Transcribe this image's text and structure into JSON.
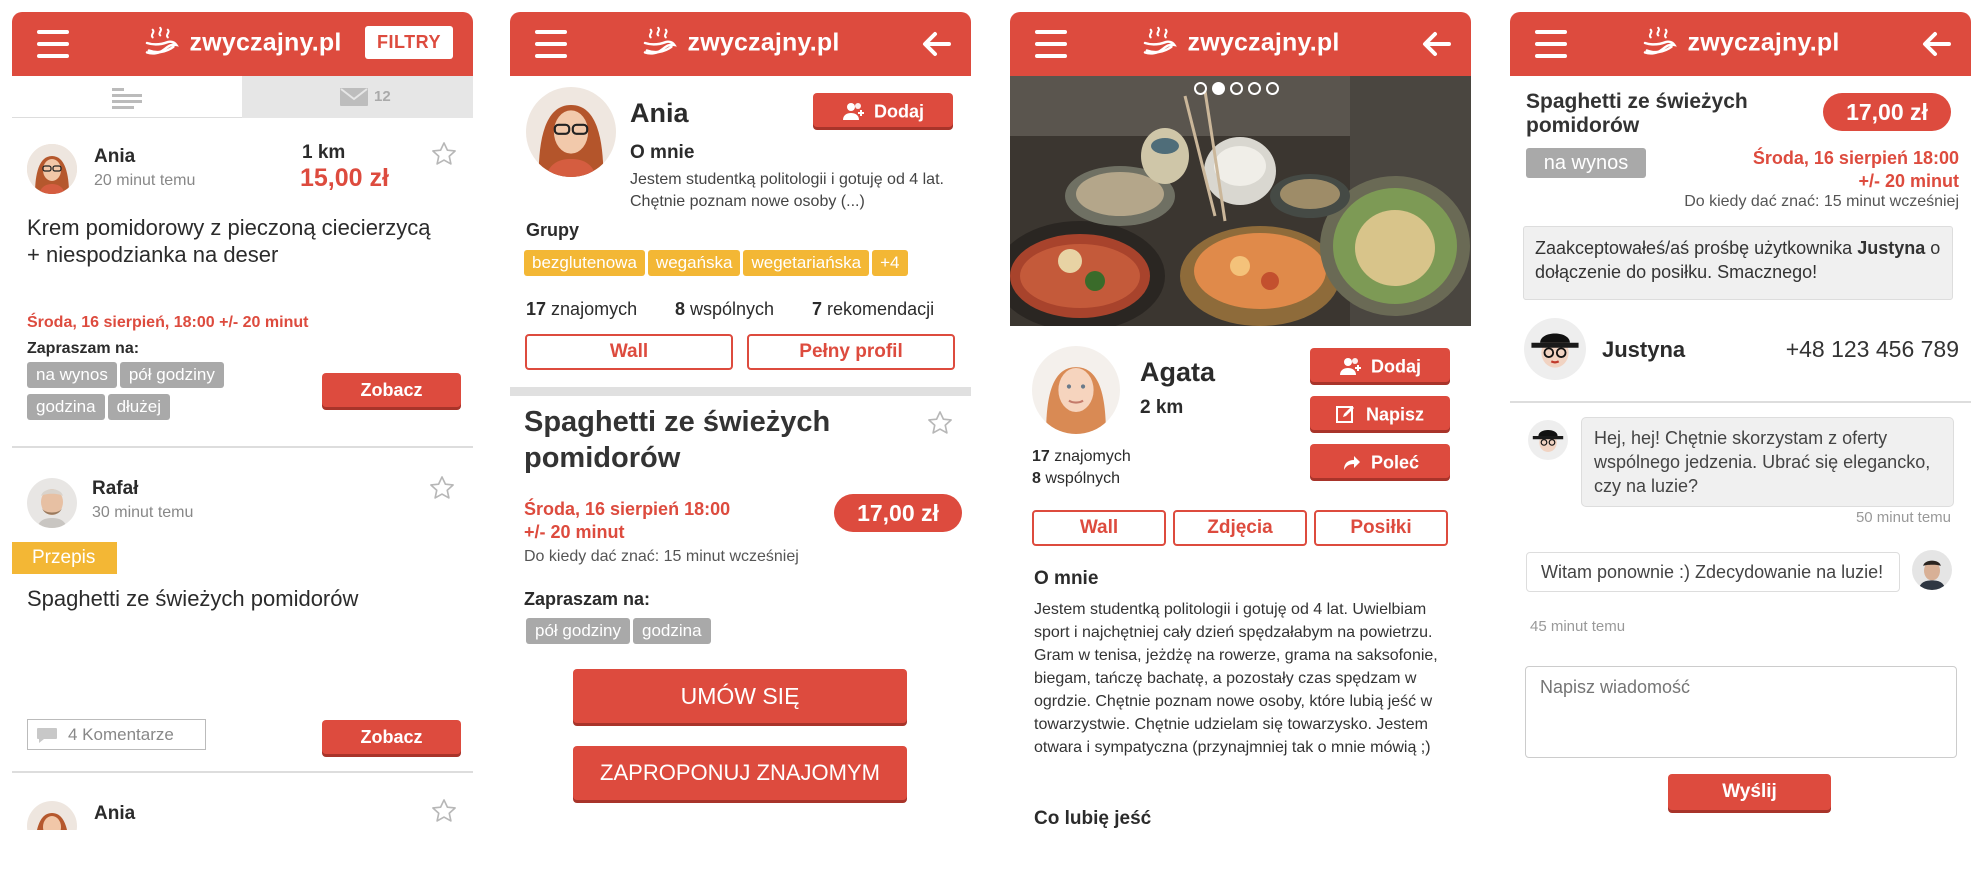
{
  "brand": {
    "logo_text": "zwyczajny.pl",
    "accent": "#dd4b3e",
    "tag_gray": "#a9a9a9",
    "tag_yellow": "#f3b735"
  },
  "screen1": {
    "filters_label": "FILTRY",
    "tabs": {
      "list_icon": "list-icon",
      "messages_icon": "envelope-icon",
      "messages_count": "12"
    },
    "card1": {
      "user": "Ania",
      "time": "20 minut temu",
      "distance": "1 km",
      "price": "15,00 zł",
      "title": "Krem pomidorowy z pieczoną ciecierzycą + niespodzianka na deser",
      "date": "Środa, 16 sierpień, 18:00 +/- 20 minut",
      "invite_label": "Zapraszam na:",
      "tags": [
        "na wynos",
        "pół godziny",
        "godzina",
        "dłużej"
      ],
      "button": "Zobacz"
    },
    "card2": {
      "user": "Rafał",
      "time": "30 minut temu",
      "badge": "Przepis",
      "title": "Spaghetti ze świeżych pomidorów",
      "comments": "4 Komentarze",
      "button": "Zobacz"
    },
    "card3": {
      "user": "Ania"
    }
  },
  "screen2": {
    "name": "Ania",
    "add_button": "Dodaj",
    "about_title": "O mnie",
    "about_text": "Jestem studentką politologii i gotuję od 4 lat. Chętnie poznam nowe osoby (...)",
    "groups_title": "Grupy",
    "groups": [
      "bezglutenowa",
      "wegańska",
      "wegetariańska",
      "+4"
    ],
    "stats": [
      {
        "num": "17",
        "label": "znajomych"
      },
      {
        "num": "8",
        "label": "wspólnych"
      },
      {
        "num": "7",
        "label": "rekomendacji"
      }
    ],
    "wall_button": "Wall",
    "profile_button": "Pełny profil",
    "dish_title": "Spaghetti ze świeżych pomidorów",
    "date_line1": "Środa, 16 sierpień 18:00",
    "date_line2": "+/- 20 minut",
    "deadline": "Do kiedy dać znać: 15 minut wcześniej",
    "price": "17,00 zł",
    "invite_label": "Zapraszam na:",
    "tags": [
      "pół godziny",
      "godzina"
    ],
    "cta1": "UMÓW SIĘ",
    "cta2": "ZAPROPONUJ ZNAJOMYM"
  },
  "screen3": {
    "gallery_dots": 5,
    "gallery_active": 2,
    "name": "Agata",
    "distance": "2 km",
    "friends": {
      "num": "17",
      "label": "znajomych"
    },
    "common": {
      "num": "8",
      "label": "wspólnych"
    },
    "add_button": "Dodaj",
    "write_button": "Napisz",
    "recommend_button": "Poleć",
    "tabs": [
      "Wall",
      "Zdjęcia",
      "Posiłki"
    ],
    "about_title": "O mnie",
    "about_text": "Jestem studentką politologii i gotuję od 4 lat. Uwielbiam sport i najchętniej cały dzień spędzałabym na powietrzu. Gram w tenisa, jeżdżę na rowerze, grama na saksofonie, biegam, tańczę bachatę, a pozostały czas spędzam w ogrdzie. Chętnie poznam nowe osoby, które lubią jeść w towarzystwie. Chętnie udzielam się towarzysko. Jestem otwara i sympatyczna (przynajmniej tak o mnie mówią ;)",
    "likes_title": "Co lubię jeść"
  },
  "screen4": {
    "dish_title": "Spaghetti ze świeżych pomidorów",
    "price": "17,00 zł",
    "tag": "na wynos",
    "date_line1": "Środa, 16 sierpień 18:00",
    "date_line2": "+/- 20 minut",
    "deadline": "Do kiedy dać znać: 15 minut wcześniej",
    "notice_pre": "Zaakceptowałeś/aś prośbę użytkownika",
    "notice_user": "Justyna",
    "notice_post": "o dołączenie do posiłku. Smacznego!",
    "contact_name": "Justyna",
    "contact_phone": "+48 123 456 789",
    "msg1": "Hej, hej! Chętnie skorzystam z oferty wspólnego jedzenia. Ubrać się elegancko, czy na luzie?",
    "msg1_time": "50 minut temu",
    "msg2": "Witam ponownie :) Zdecydowanie na luzie!",
    "msg2_time": "45 minut temu",
    "input_placeholder": "Napisz wiadomość",
    "send_button": "Wyślij"
  }
}
